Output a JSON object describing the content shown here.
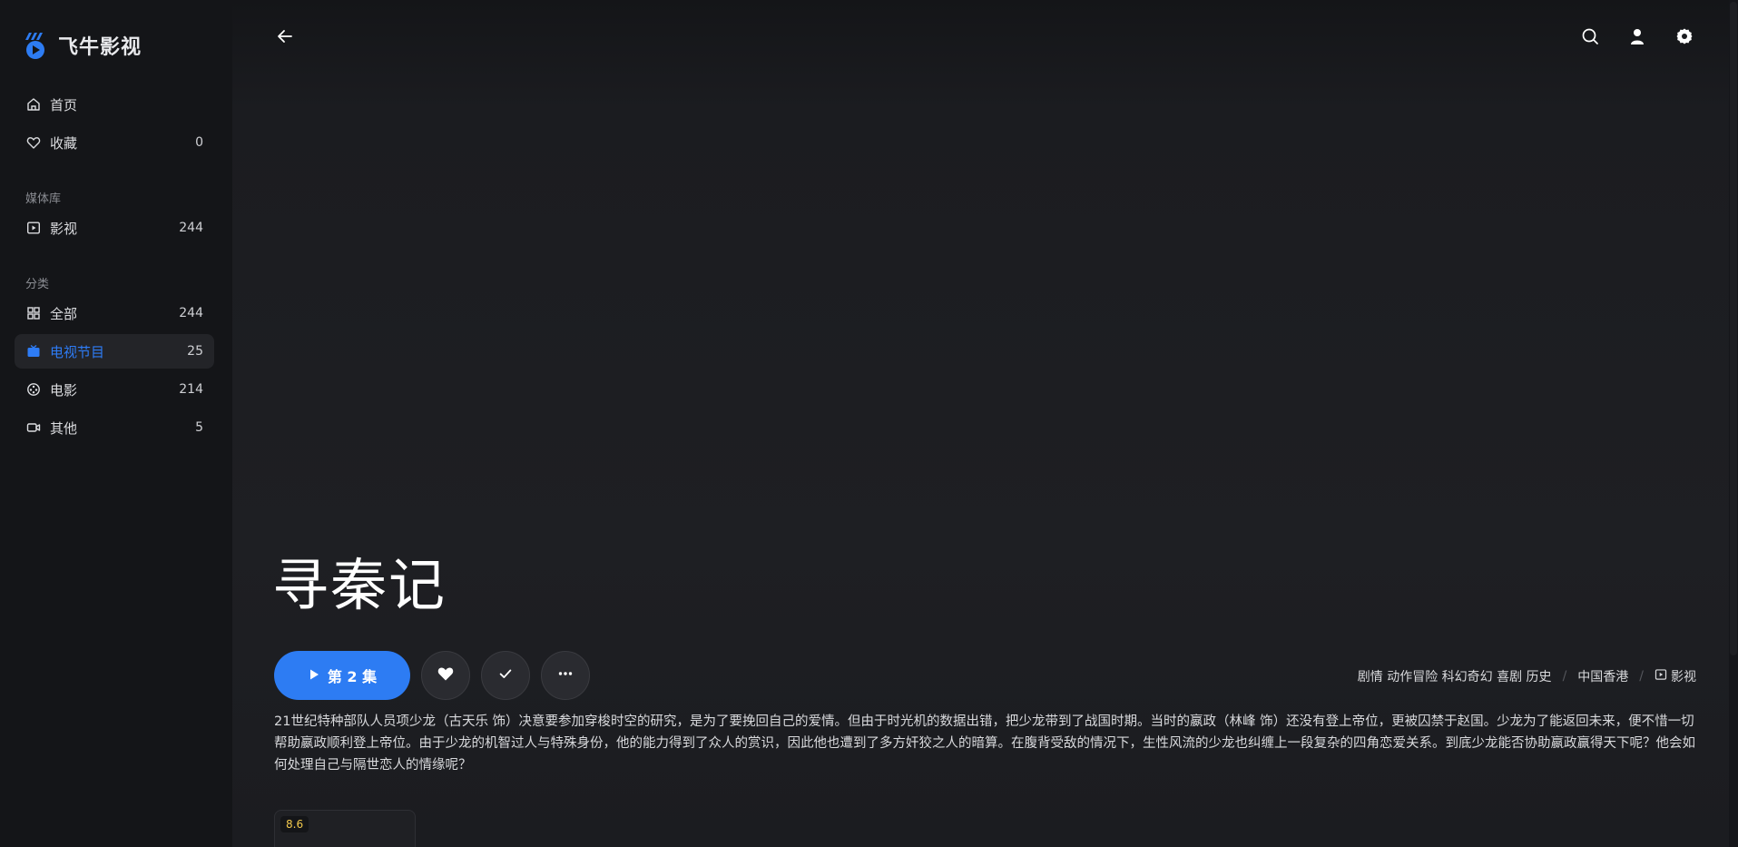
{
  "app": {
    "logo_text": "飞牛影视",
    "brand_color": "#2d7cf3"
  },
  "sidebar": {
    "home": {
      "label": "首页",
      "icon": "home-icon"
    },
    "favorites": {
      "label": "收藏",
      "count": "0",
      "icon": "heart-icon"
    },
    "library_section": "媒体库",
    "library": [
      {
        "label": "影视",
        "count": "244",
        "icon": "video-library-icon"
      }
    ],
    "category_section": "分类",
    "categories": [
      {
        "label": "全部",
        "count": "244",
        "icon": "grid-icon"
      },
      {
        "label": "电视节目",
        "count": "25",
        "icon": "tv-icon",
        "active": true
      },
      {
        "label": "电影",
        "count": "214",
        "icon": "film-reel-icon"
      },
      {
        "label": "其他",
        "count": "5",
        "icon": "camera-icon"
      }
    ]
  },
  "header": {
    "back_icon": "arrow-left-icon",
    "icons": [
      "search-icon",
      "user-icon",
      "gear-icon"
    ]
  },
  "detail": {
    "title": "寻秦记",
    "play_label": "第 2 集",
    "action_icons": [
      "heart-icon",
      "check-icon",
      "more-icon"
    ],
    "genres": "剧情 动作冒险 科幻奇幻 喜剧 历史",
    "region": "中国香港",
    "library": "影视",
    "description": "21世纪特种部队人员项少龙（古天乐 饰）决意要参加穿梭时空的研究，是为了要挽回自己的爱情。但由于时光机的数据出错，把少龙带到了战国时期。当时的嬴政（林峰 饰）还没有登上帝位，更被囚禁于赵国。少龙为了能返回未来，便不惜一切帮助嬴政顺利登上帝位。由于少龙的机智过人与特殊身份，他的能力得到了众人的赏识，因此他也遭到了多方奸狡之人的暗算。在腹背受敌的情况下，生性风流的少龙也纠缠上一段复杂的四角恋爱关系。到底少龙能否协助嬴政赢得天下呢？他会如何处理自己与隔世恋人的情缘呢？",
    "rating": "8.6"
  }
}
